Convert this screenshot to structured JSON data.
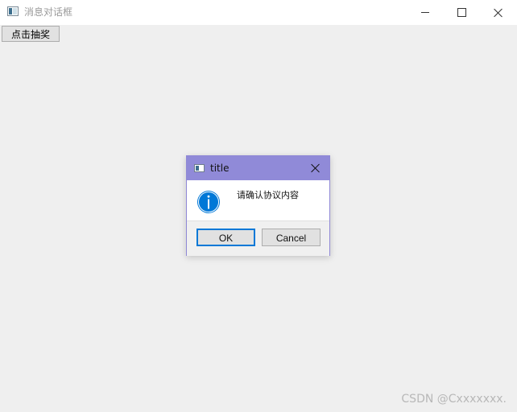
{
  "window": {
    "title": "消息对话框",
    "icon": "app-window-icon"
  },
  "main": {
    "lottery_button_label": "点击抽奖"
  },
  "dialog": {
    "title": "title",
    "icon": "app-window-icon",
    "message": "请确认协议内容",
    "message_icon": "info-icon",
    "ok_label": "OK",
    "cancel_label": "Cancel"
  },
  "watermark": {
    "text": "CSDN @Cxxxxxxx."
  },
  "colors": {
    "dialog_titlebar": "#908ad8",
    "dialog_border": "#8f88d6",
    "info_icon": "#0078d7",
    "ok_focus_border": "#0078d7",
    "window_background": "#efefef"
  }
}
